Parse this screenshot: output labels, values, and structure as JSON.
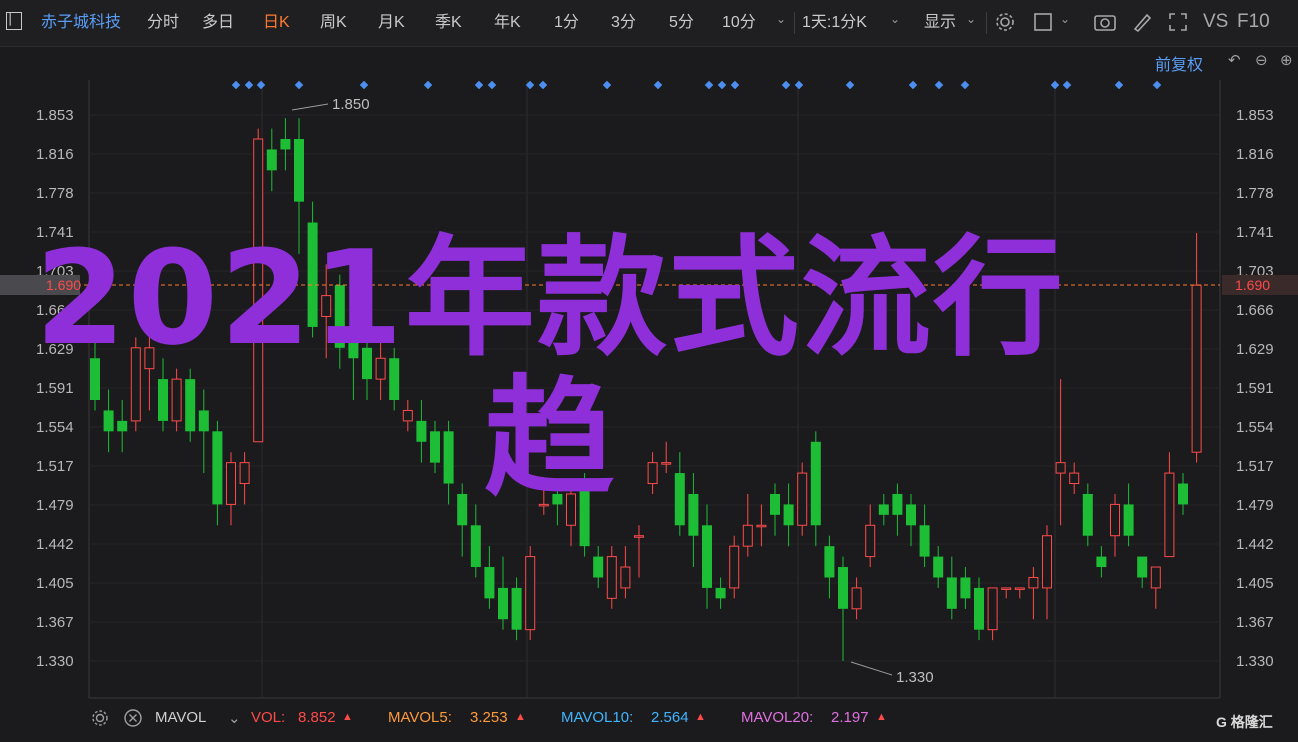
{
  "toolbar": {
    "stock_name": "赤子城科技",
    "periods": [
      "分时",
      "多日",
      "日K",
      "周K",
      "月K",
      "季K",
      "年K",
      "1分",
      "3分",
      "5分",
      "10分"
    ],
    "active_period": "日K",
    "range_select": "1天:1分K",
    "display_label": "显示",
    "vs_label": "VS",
    "f10_label": "F10"
  },
  "subbar": {
    "adjust_label": "前复权"
  },
  "y_axis_left": [
    "1.853",
    "1.816",
    "1.778",
    "1.741",
    "1.703",
    "1.666",
    "1.629",
    "1.591",
    "1.554",
    "1.517",
    "1.479",
    "1.442",
    "1.405",
    "1.367",
    "1.330"
  ],
  "y_axis_right": [
    "1.853",
    "1.816",
    "1.778",
    "1.741",
    "1.703",
    "1.666",
    "1.629",
    "1.591",
    "1.554",
    "1.517",
    "1.479",
    "1.442",
    "1.405",
    "1.367",
    "1.330"
  ],
  "current_price": "1.690",
  "current_price_left": "1.690",
  "high_label": "1.850",
  "low_label": "1.330",
  "indicator": {
    "name": "MAVOL",
    "vol_label": "VOL:",
    "vol_value": "8.852",
    "mavol5_label": "MAVOL5:",
    "mavol5_value": "3.253",
    "mavol10_label": "MAVOL10:",
    "mavol10_value": "2.564",
    "mavol20_label": "MAVOL20:",
    "mavol20_value": "2.197"
  },
  "colors": {
    "up": "#ff4a4a",
    "down": "#1dbe36",
    "accent": "#ff7a2f",
    "link": "#5a9df5",
    "watermark": "#8f2fd9"
  },
  "watermark_line1": "2021年款式流行",
  "watermark_line2": "趋",
  "logo_text": "格隆汇",
  "chart_data": {
    "type": "candlestick",
    "ylim": [
      1.31,
      1.87
    ],
    "candles": [
      [
        1.62,
        1.58,
        1.64,
        1.57
      ],
      [
        1.57,
        1.55,
        1.59,
        1.53
      ],
      [
        1.56,
        1.55,
        1.58,
        1.53
      ],
      [
        1.56,
        1.63,
        1.64,
        1.55
      ],
      [
        1.61,
        1.63,
        1.67,
        1.57
      ],
      [
        1.6,
        1.56,
        1.62,
        1.55
      ],
      [
        1.56,
        1.6,
        1.61,
        1.55
      ],
      [
        1.6,
        1.55,
        1.61,
        1.54
      ],
      [
        1.57,
        1.55,
        1.59,
        1.51
      ],
      [
        1.55,
        1.48,
        1.56,
        1.46
      ],
      [
        1.48,
        1.52,
        1.53,
        1.46
      ],
      [
        1.5,
        1.52,
        1.53,
        1.48
      ],
      [
        1.54,
        1.83,
        1.84,
        1.54
      ],
      [
        1.82,
        1.8,
        1.84,
        1.78
      ],
      [
        1.83,
        1.82,
        1.85,
        1.8
      ],
      [
        1.83,
        1.77,
        1.85,
        1.72
      ],
      [
        1.75,
        1.65,
        1.77,
        1.64
      ],
      [
        1.66,
        1.68,
        1.71,
        1.62
      ],
      [
        1.69,
        1.63,
        1.7,
        1.61
      ],
      [
        1.65,
        1.62,
        1.67,
        1.58
      ],
      [
        1.63,
        1.6,
        1.65,
        1.58
      ],
      [
        1.6,
        1.62,
        1.64,
        1.58
      ],
      [
        1.62,
        1.58,
        1.63,
        1.57
      ],
      [
        1.56,
        1.57,
        1.58,
        1.55
      ],
      [
        1.56,
        1.54,
        1.58,
        1.52
      ],
      [
        1.55,
        1.52,
        1.56,
        1.51
      ],
      [
        1.55,
        1.5,
        1.56,
        1.48
      ],
      [
        1.49,
        1.46,
        1.5,
        1.43
      ],
      [
        1.46,
        1.42,
        1.48,
        1.41
      ],
      [
        1.42,
        1.39,
        1.44,
        1.38
      ],
      [
        1.4,
        1.37,
        1.43,
        1.36
      ],
      [
        1.4,
        1.36,
        1.41,
        1.35
      ],
      [
        1.36,
        1.43,
        1.44,
        1.35
      ],
      [
        1.48,
        1.48,
        1.5,
        1.47
      ],
      [
        1.49,
        1.48,
        1.5,
        1.46
      ],
      [
        1.46,
        1.49,
        1.5,
        1.44
      ],
      [
        1.5,
        1.44,
        1.51,
        1.43
      ],
      [
        1.43,
        1.41,
        1.44,
        1.4
      ],
      [
        1.39,
        1.43,
        1.44,
        1.38
      ],
      [
        1.4,
        1.42,
        1.44,
        1.39
      ],
      [
        1.45,
        1.45,
        1.46,
        1.41
      ],
      [
        1.5,
        1.52,
        1.53,
        1.49
      ],
      [
        1.52,
        1.52,
        1.54,
        1.51
      ],
      [
        1.51,
        1.46,
        1.53,
        1.45
      ],
      [
        1.49,
        1.45,
        1.51,
        1.42
      ],
      [
        1.46,
        1.4,
        1.48,
        1.38
      ],
      [
        1.4,
        1.39,
        1.41,
        1.38
      ],
      [
        1.4,
        1.44,
        1.45,
        1.39
      ],
      [
        1.44,
        1.46,
        1.49,
        1.43
      ],
      [
        1.46,
        1.46,
        1.48,
        1.44
      ],
      [
        1.49,
        1.47,
        1.5,
        1.45
      ],
      [
        1.48,
        1.46,
        1.5,
        1.44
      ],
      [
        1.46,
        1.51,
        1.52,
        1.45
      ],
      [
        1.54,
        1.46,
        1.55,
        1.44
      ],
      [
        1.44,
        1.41,
        1.45,
        1.39
      ],
      [
        1.42,
        1.38,
        1.43,
        1.33
      ],
      [
        1.38,
        1.4,
        1.41,
        1.37
      ],
      [
        1.43,
        1.46,
        1.48,
        1.42
      ],
      [
        1.48,
        1.47,
        1.49,
        1.46
      ],
      [
        1.49,
        1.47,
        1.5,
        1.45
      ],
      [
        1.48,
        1.46,
        1.49,
        1.44
      ],
      [
        1.46,
        1.43,
        1.48,
        1.42
      ],
      [
        1.43,
        1.41,
        1.44,
        1.4
      ],
      [
        1.41,
        1.38,
        1.43,
        1.37
      ],
      [
        1.41,
        1.39,
        1.42,
        1.38
      ],
      [
        1.4,
        1.36,
        1.41,
        1.35
      ],
      [
        1.36,
        1.4,
        1.4,
        1.35
      ],
      [
        1.4,
        1.4,
        1.4,
        1.39
      ],
      [
        1.4,
        1.4,
        1.4,
        1.39
      ],
      [
        1.4,
        1.41,
        1.42,
        1.37
      ],
      [
        1.4,
        1.45,
        1.46,
        1.37
      ],
      [
        1.51,
        1.52,
        1.6,
        1.46
      ],
      [
        1.5,
        1.51,
        1.52,
        1.49
      ],
      [
        1.49,
        1.45,
        1.5,
        1.44
      ],
      [
        1.43,
        1.42,
        1.44,
        1.41
      ],
      [
        1.45,
        1.48,
        1.49,
        1.43
      ],
      [
        1.48,
        1.45,
        1.5,
        1.44
      ],
      [
        1.43,
        1.41,
        1.43,
        1.4
      ],
      [
        1.4,
        1.42,
        1.42,
        1.38
      ],
      [
        1.43,
        1.51,
        1.53,
        1.43
      ],
      [
        1.5,
        1.48,
        1.51,
        1.47
      ],
      [
        1.53,
        1.69,
        1.74,
        1.52
      ]
    ]
  }
}
